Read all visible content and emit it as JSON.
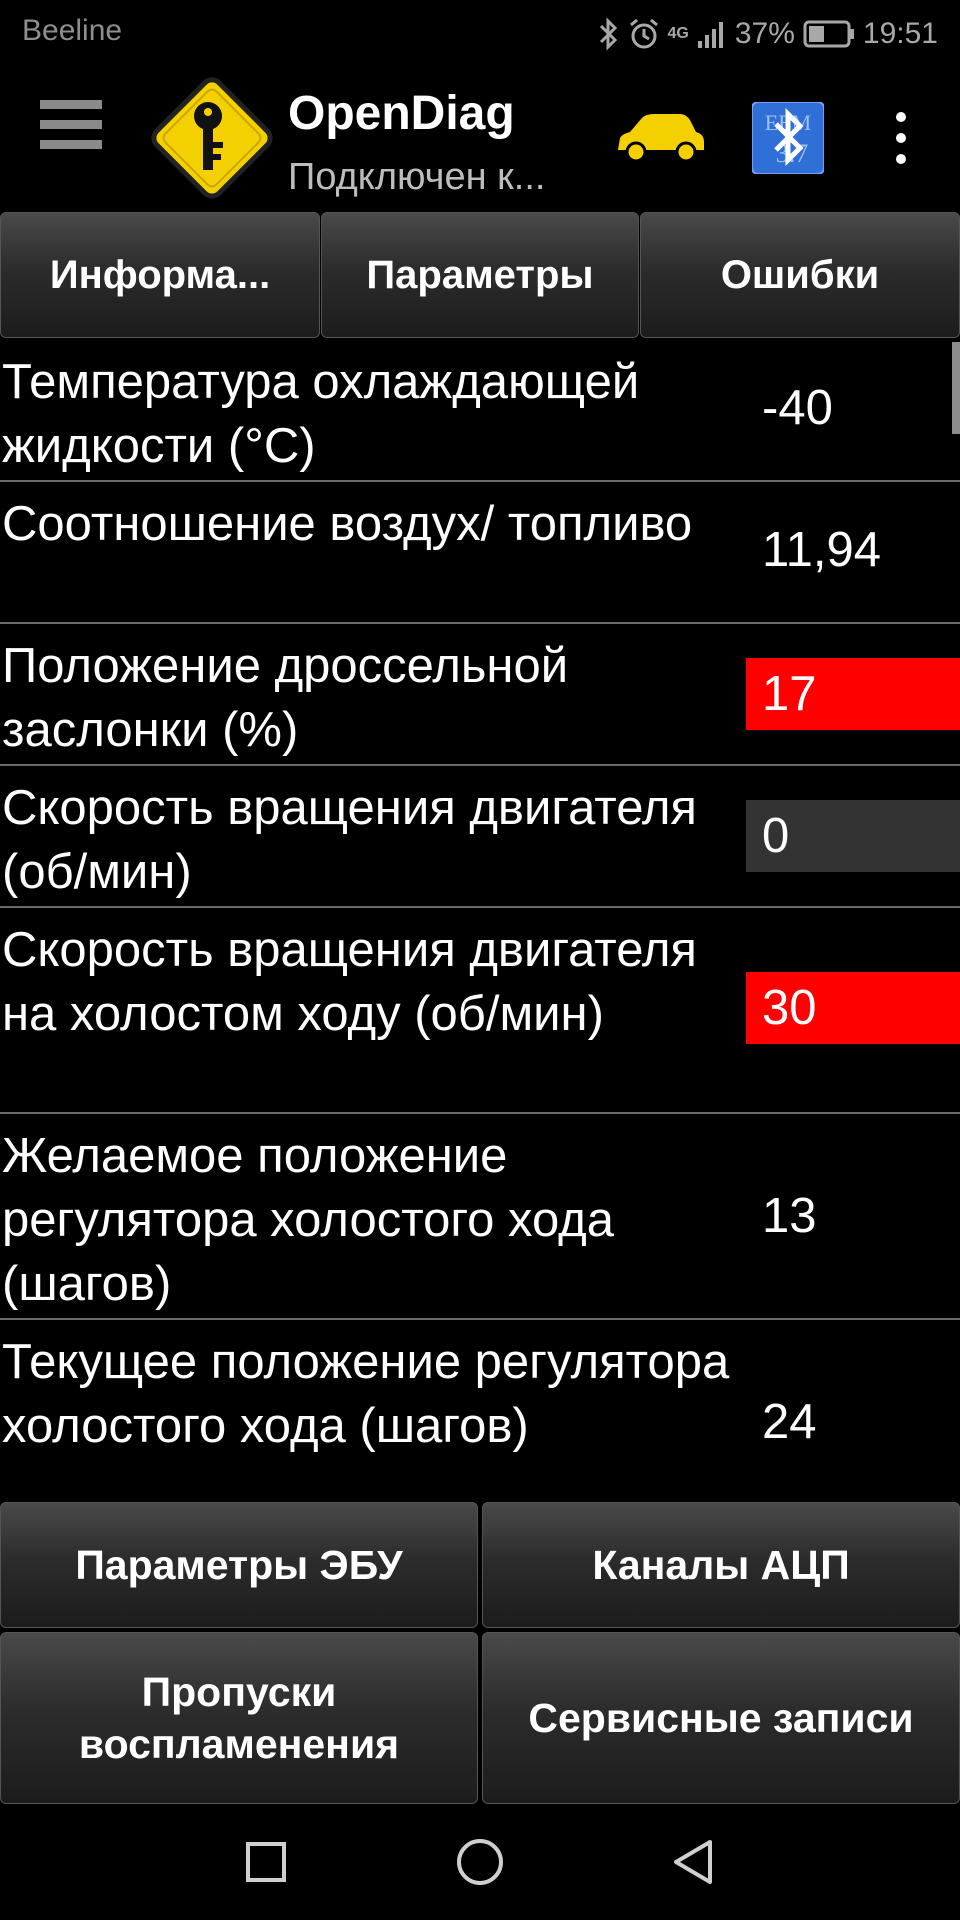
{
  "status_bar": {
    "carrier": "Beeline",
    "network": "4G",
    "battery": "37%",
    "time": "19:51",
    "icons": [
      "bluetooth-icon",
      "alarm-icon",
      "signal-icon",
      "battery-icon"
    ]
  },
  "app_bar": {
    "title": "OpenDiag",
    "subtitle": "Подключен к...",
    "icons": [
      "menu-icon",
      "app-logo-key-icon",
      "car-icon",
      "bluetooth-ecu-icon",
      "more-vert-icon"
    ],
    "bt_badge_text": "ЕЕМ 3.7"
  },
  "tabs": [
    {
      "label": "Информа..."
    },
    {
      "label": "Параметры"
    },
    {
      "label": "Ошибки"
    }
  ],
  "parameters": [
    {
      "label": "Температура охлаждающей жидкости (°C)",
      "value": "-40",
      "state": "normal"
    },
    {
      "label": "Соотношение воздух/ топливо",
      "value": "11,94",
      "state": "normal"
    },
    {
      "label": "Положение дроссельной заслонки (%)",
      "value": "17",
      "state": "alarm"
    },
    {
      "label": "Скорость вращения двигателя (об/мин)",
      "value": "0",
      "state": "neutral"
    },
    {
      "label": "Скорость вращения двигателя на холостом ходу (об/мин)",
      "value": "30",
      "state": "alarm"
    },
    {
      "label": "Желаемое положение регулятора холостого хода (шагов)",
      "value": "13",
      "state": "normal"
    },
    {
      "label": "Текущее положение регулятора холостого хода (шагов)",
      "value": "24",
      "state": "normal"
    }
  ],
  "bottom_buttons": [
    {
      "label": "Параметры ЭБУ"
    },
    {
      "label": "Каналы АЦП"
    },
    {
      "label": "Пропуски воспламенения"
    },
    {
      "label": "Сервисные записи"
    }
  ],
  "nav_bar": {
    "icons": [
      "recents-square-icon",
      "home-circle-icon",
      "back-triangle-icon"
    ]
  },
  "colors": {
    "alarm": "#ff0000",
    "neutral": "#333333",
    "logo_yellow": "#f5d000",
    "car_yellow": "#f5d000",
    "bt_blue": "#2f6fd6"
  }
}
